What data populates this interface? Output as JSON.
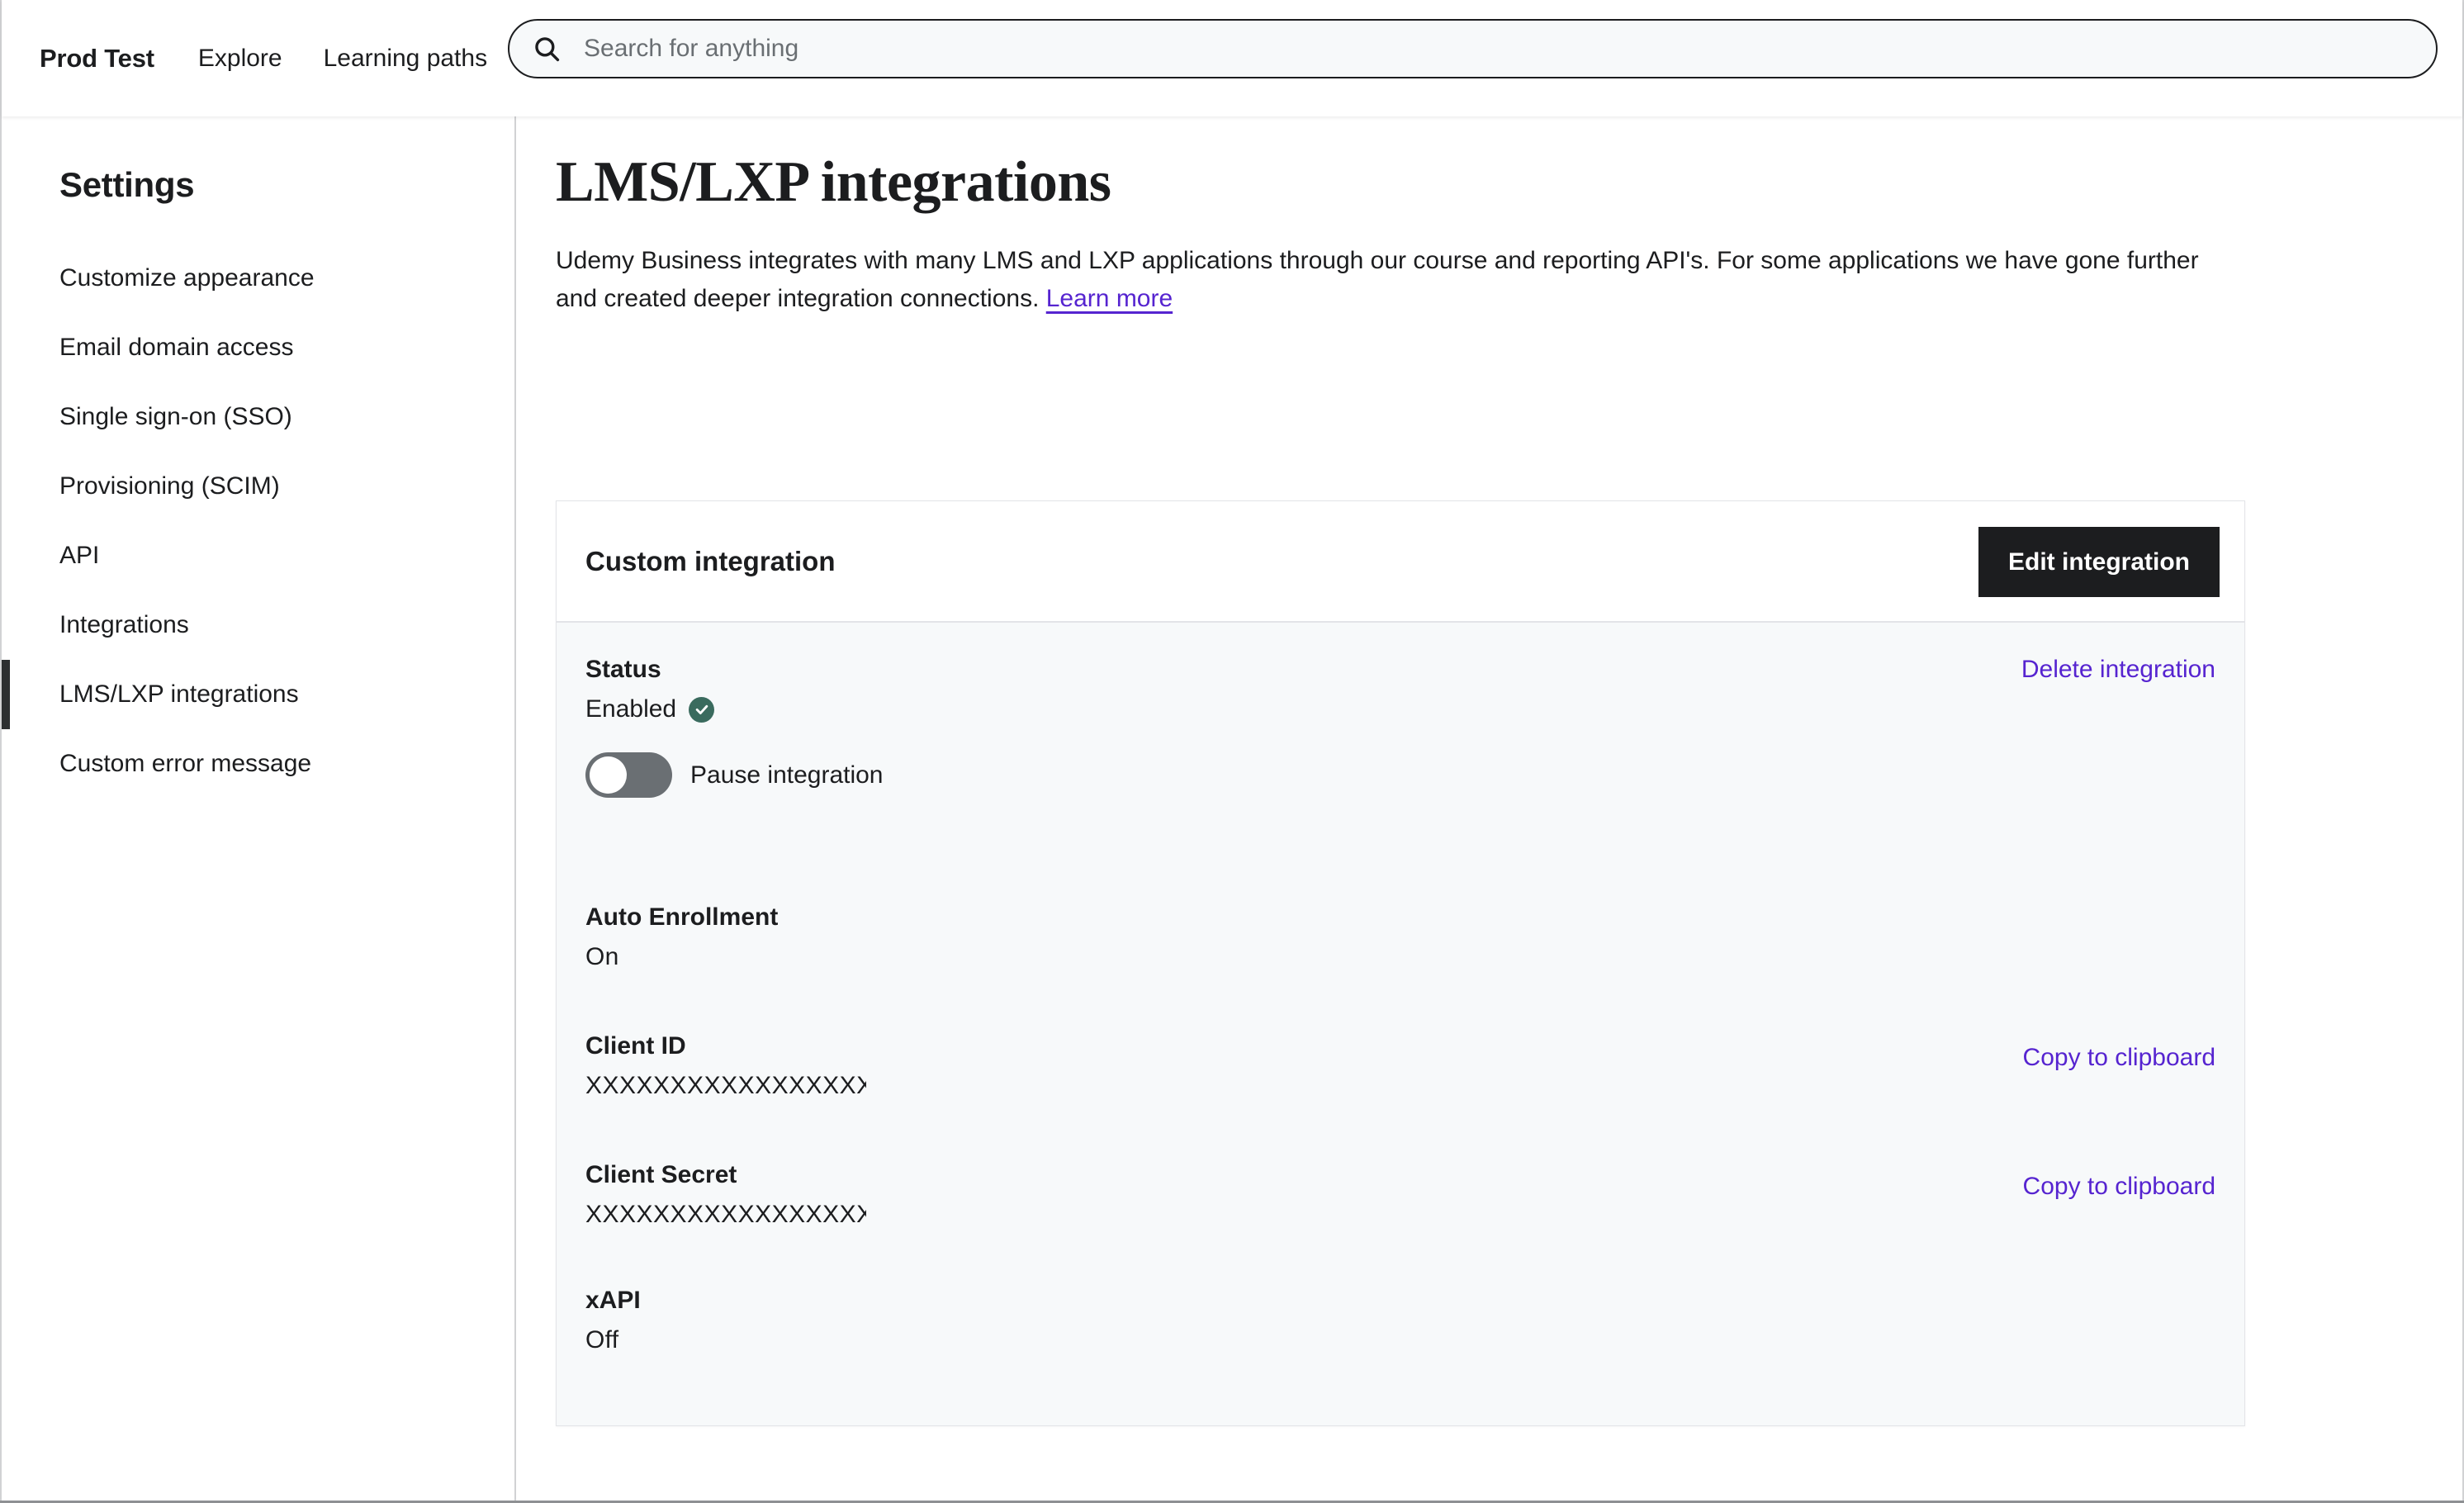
{
  "header": {
    "brand": "Prod Test",
    "nav": [
      {
        "label": "Explore"
      },
      {
        "label": "Learning paths"
      }
    ],
    "search": {
      "placeholder": "Search for anything",
      "value": "",
      "icon": "search-icon"
    }
  },
  "sidebar": {
    "title": "Settings",
    "items": [
      {
        "label": "Customize appearance",
        "active": false
      },
      {
        "label": "Email domain access",
        "active": false
      },
      {
        "label": "Single sign-on (SSO)",
        "active": false
      },
      {
        "label": "Provisioning (SCIM)",
        "active": false
      },
      {
        "label": "API",
        "active": false
      },
      {
        "label": "Integrations",
        "active": false
      },
      {
        "label": "LMS/LXP integrations",
        "active": true
      },
      {
        "label": "Custom error message",
        "active": false
      }
    ]
  },
  "main": {
    "page_title": "LMS/LXP integrations",
    "description_part1": "Udemy Business integrates with many LMS and LXP applications through our course and reporting API's. For some applications we have gone further and created deeper integration connections. ",
    "learn_more_label": "Learn more",
    "card": {
      "title": "Custom integration",
      "edit_button_label": "Edit integration",
      "status": {
        "label": "Status",
        "value": "Enabled",
        "badge_icon": "check-circle-icon",
        "delete_link_label": "Delete integration",
        "toggle": {
          "label": "Pause integration",
          "state": "off"
        }
      },
      "auto_enrollment": {
        "label": "Auto Enrollment",
        "value": "On"
      },
      "client_id": {
        "label": "Client ID",
        "value": "XXXXXXXXXXXXXXXXX",
        "copy_link_label": "Copy to clipboard"
      },
      "client_secret": {
        "label": "Client Secret",
        "value": "XXXXXXXXXXXXXXXXX",
        "copy_link_label": "Copy to clipboard"
      },
      "xapi": {
        "label": "xAPI",
        "value": "Off"
      }
    }
  },
  "colors": {
    "accent_purple": "#5624d0",
    "dark": "#1c1d1f",
    "success_green": "#3a6b5e",
    "toggle_gray": "#6a6f73",
    "card_body_bg": "#f7f9fa"
  }
}
